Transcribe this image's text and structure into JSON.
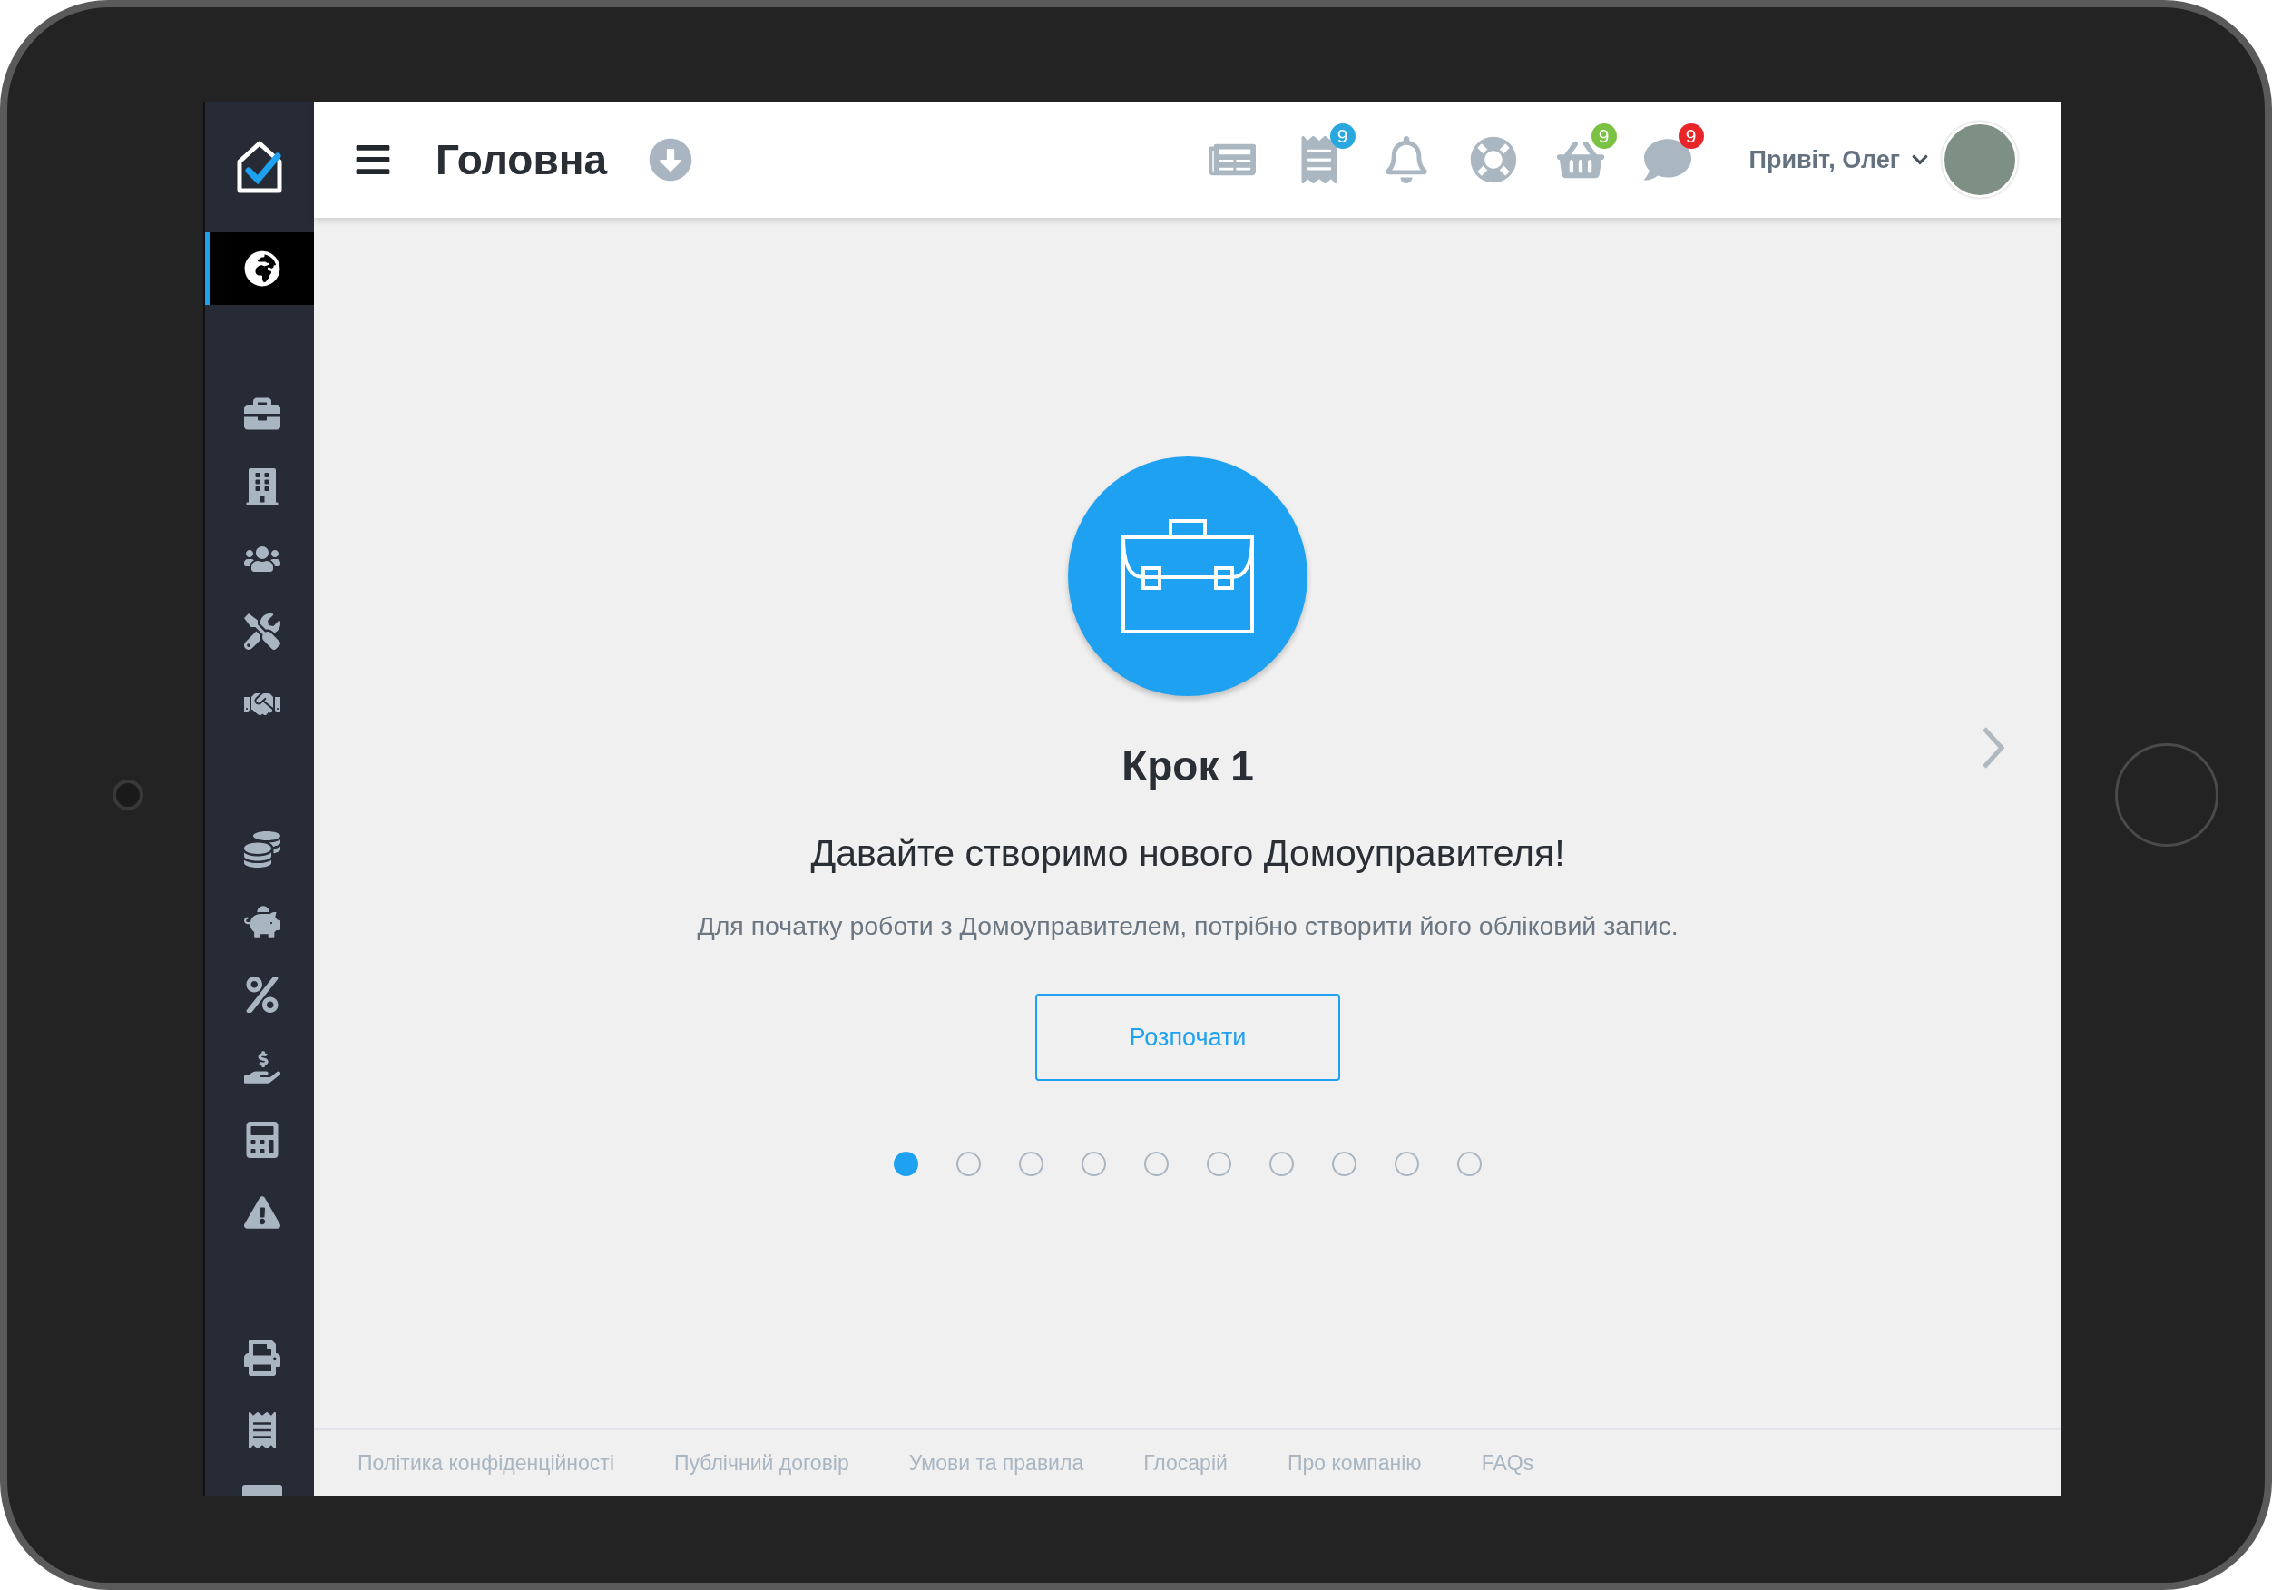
{
  "sidebar": {
    "groups": [
      {
        "items": [
          {
            "selected": true
          }
        ]
      },
      {
        "items": [
          {
            "selected": false
          },
          {
            "selected": false
          },
          {
            "selected": false
          },
          {
            "selected": false
          },
          {
            "selected": false
          }
        ]
      },
      {
        "items": [
          {
            "selected": false
          },
          {
            "selected": false
          },
          {
            "selected": false
          },
          {
            "selected": false
          },
          {
            "selected": false
          },
          {
            "selected": false
          }
        ]
      },
      {
        "items": [
          {
            "selected": false
          },
          {
            "selected": false
          },
          {
            "selected": false
          }
        ]
      }
    ]
  },
  "header": {
    "title": "Головна",
    "actions": [
      {
        "kind": "news"
      },
      {
        "kind": "receipt",
        "badge": "9",
        "color": "#29a8e0"
      },
      {
        "kind": "bell"
      },
      {
        "kind": "help"
      },
      {
        "kind": "basket",
        "badge": "9",
        "color": "#7cc242"
      },
      {
        "kind": "chat",
        "badge": "9",
        "color": "#e8262a"
      }
    ],
    "greeting": "Привіт, Олег"
  },
  "step": {
    "title": "Крок 1",
    "heading": "Давайте створимо нового Домоуправителя!",
    "description": "Для початку роботи з Домоуправителем, потрібно створити його обліковий запис.",
    "button": "Розпочати"
  },
  "carousel": {
    "dots": [
      {
        "selected": true
      },
      {
        "selected": false
      },
      {
        "selected": false
      },
      {
        "selected": false
      },
      {
        "selected": false
      },
      {
        "selected": false
      },
      {
        "selected": false
      },
      {
        "selected": false
      },
      {
        "selected": false
      },
      {
        "selected": false
      }
    ]
  },
  "footer": {
    "links": [
      "Політика конфіденційності",
      "Публічний договір",
      "Умови та правила",
      "Глосарій",
      "Про компанію",
      "FAQs"
    ]
  }
}
